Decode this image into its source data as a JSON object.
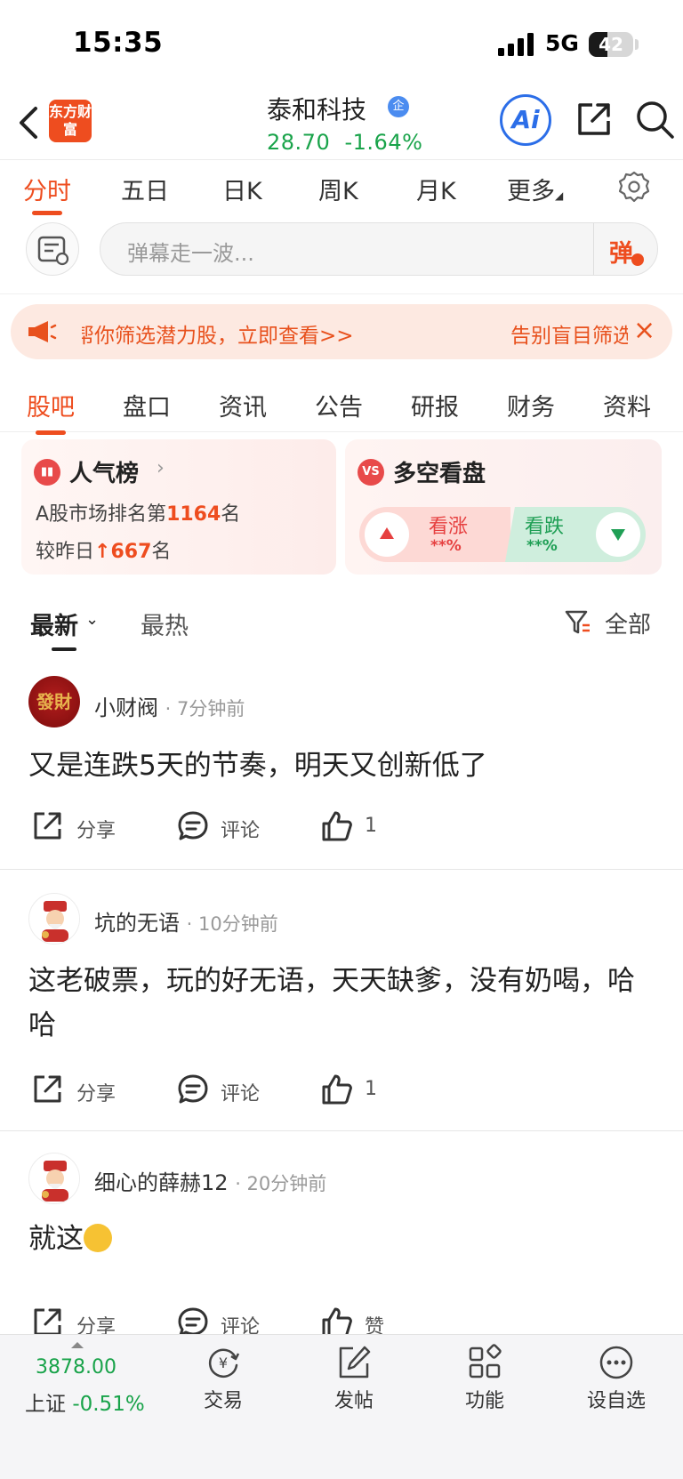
{
  "status_bar": {
    "time": "15:35",
    "network": "5G",
    "battery": "42"
  },
  "header": {
    "logo_text": "东方财富",
    "stock_name": "泰和科技",
    "badge": "企",
    "price": "28.70",
    "change": "-1.64%",
    "ai_label": "Ai"
  },
  "chart_tabs": [
    {
      "label": "分时"
    },
    {
      "label": "五日"
    },
    {
      "label": "日K"
    },
    {
      "label": "周K"
    },
    {
      "label": "月K"
    },
    {
      "label": "更多"
    }
  ],
  "danmaku": {
    "placeholder": "弹幕走一波...",
    "button": "弹"
  },
  "promo": {
    "text": "帮你筛选潜力股，立即查看>>",
    "text_right": "告别盲目筛选",
    "close": "×"
  },
  "main_tabs": [
    {
      "label": "股吧"
    },
    {
      "label": "盘口"
    },
    {
      "label": "资讯"
    },
    {
      "label": "公告"
    },
    {
      "label": "研报"
    },
    {
      "label": "财务"
    },
    {
      "label": "资料"
    }
  ],
  "popularity": {
    "title": "人气榜",
    "rank_prefix": "A股市场排名第",
    "rank": "1164",
    "rank_suffix": "名",
    "change_prefix": "较昨日",
    "change_arrow": "↑",
    "change_value": "667",
    "change_suffix": "名"
  },
  "sentiment": {
    "title": "多空看盘",
    "icon": "VS",
    "up_label": "看涨",
    "up_pct": "**%",
    "down_label": "看跌",
    "down_pct": "**%"
  },
  "sort": {
    "latest": "最新",
    "hot": "最热",
    "filter": "全部"
  },
  "posts": [
    {
      "user": "小财阀",
      "avatar_text": "發財",
      "time": "· 7分钟前",
      "content": "又是连跌5天的节奏，明天又创新低了",
      "share": "分享",
      "comment": "评论",
      "likes": "1"
    },
    {
      "user": "坑的无语",
      "time": "· 10分钟前",
      "content": "这老破票，玩的好无语，天天缺爹，没有奶喝，哈哈",
      "share": "分享",
      "comment": "评论",
      "likes": "1"
    },
    {
      "user": "细心的薛赫12",
      "time": "· 20分钟前",
      "content": "就这",
      "share": "分享",
      "comment": "评论",
      "likes": "赞"
    }
  ],
  "bottom_bar": {
    "index_value": "3878.00",
    "index_name": "上证",
    "index_change": "-0.51%",
    "items": [
      {
        "label": "交易",
        "icon": "yen-exchange-icon"
      },
      {
        "label": "发帖",
        "icon": "edit-icon"
      },
      {
        "label": "功能",
        "icon": "grid-icon"
      },
      {
        "label": "设自选",
        "icon": "more-dots-icon"
      }
    ]
  },
  "colors": {
    "accent": "#ee4d1f",
    "down_green": "#19a34a",
    "up_red": "#e64040"
  }
}
